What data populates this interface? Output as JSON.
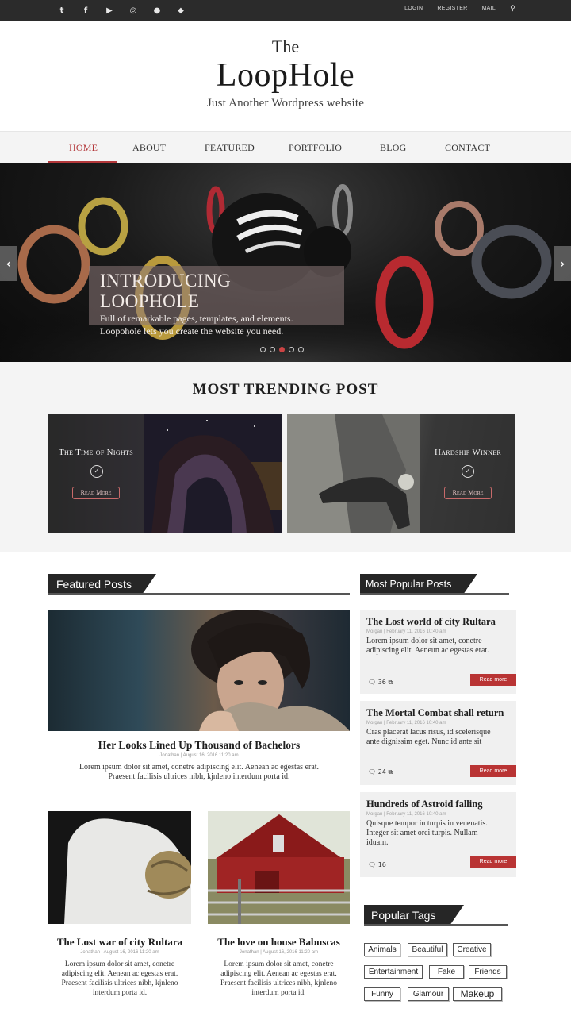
{
  "topbar": {
    "social": [
      {
        "icon": "twitter-icon",
        "glyph": "t"
      },
      {
        "icon": "facebook-icon",
        "glyph": "f"
      },
      {
        "icon": "youtube-icon",
        "glyph": "▶"
      },
      {
        "icon": "dribbble-icon",
        "glyph": "◎"
      },
      {
        "icon": "apple-icon",
        "glyph": "●"
      },
      {
        "icon": "android-icon",
        "glyph": "◆"
      }
    ],
    "login": "LOGIN",
    "register": "REGISTER",
    "mail": "MAIL",
    "search_glyph": "⚲"
  },
  "brand": {
    "the": "The",
    "name": "LoopHole",
    "tagline": "Just Another Wordpress website"
  },
  "nav": {
    "items": [
      "HOME",
      "ABOUT",
      "FEATURED",
      "PORTFOLIO",
      "BLOG",
      "CONTACT"
    ]
  },
  "hero": {
    "title": "INTRODUCING LOOPHOLE",
    "line1": "Full of remarkable pages, templates, and elements.",
    "line2": "Loopohole lets you create the website you need.",
    "prev": "‹",
    "next": "›"
  },
  "trending": {
    "heading": "MOST TRENDING POST",
    "cards": [
      {
        "title": "The Time of Nights",
        "button": "Read More"
      },
      {
        "title": "Hardship Winner",
        "button": "Read More"
      }
    ]
  },
  "featured": {
    "heading": "Featured Posts",
    "main": {
      "title": "Her Looks Lined Up Thousand of Bachelors",
      "meta": "Jonathan | August 16, 2016 11:20 am",
      "body1": "Lorem ipsum dolor sit amet, conetre adipiscing elit. Aenean ac egestas erat.",
      "body2": "Praesent facilisis ultrices nibh, kjnleno interdum porta id."
    },
    "posts": [
      {
        "title": "The Lost war of city Rultara",
        "meta": "Jonathan | August 16, 2016 11:20 am",
        "body1": "Lorem ipsum dolor sit amet, conetre",
        "body2": "adipiscing elit. Aenean ac egestas erat.",
        "body3": "Praesent facilisis ultrices nibh, kjnleno",
        "body4": "interdum porta id."
      },
      {
        "title": "The love on house Babuscas",
        "meta": "Jonathan | August 16, 2016 11:20 am",
        "body1": "Lorem ipsum dolor sit amet, conetre",
        "body2": "adipiscing elit. Aenean ac egestas erat.",
        "body3": "Praesent facilisis ultrices nibh, kjnleno",
        "body4": "interdum porta id."
      }
    ]
  },
  "popular": {
    "heading": "Most Popular Posts",
    "posts": [
      {
        "title": "The Lost world of city Rultara",
        "meta": "Morgan | February 11, 2016 10:40 am",
        "body1": "Lorem ipsum dolor sit amet, conetre",
        "body2": "adipiscing elit. Aeneun ac egestas erat.",
        "count": "36",
        "button": "Read more"
      },
      {
        "title": "The Mortal Combat shall return",
        "meta": "Morgan | February 11, 2016 10:40 am",
        "body1": "Cras placerat lacus risus, id scelerisque",
        "body2": "ante dignissim eget. Nunc id ante sit",
        "count": "24",
        "button": "Read more"
      },
      {
        "title": "Hundreds of Astroid falling",
        "meta": "Morgan | February 11, 2016 10:40 am",
        "body1": "Quisque tempor in turpis in venenatis.",
        "body2": "Integer sit amet orci turpis. Nullam",
        "body3": "iduam.",
        "count": "16",
        "button": "Read more"
      }
    ]
  },
  "tags": {
    "heading": "Popular Tags",
    "items": [
      "Animals",
      "Beautiful",
      "Creative",
      "Entertainment",
      "Fake",
      "Friends",
      "Funny",
      "Glamour",
      "Makeup"
    ]
  },
  "colors": {
    "accent": "#b3373a",
    "dark": "#262626",
    "topbar": "#2b2b2b"
  }
}
